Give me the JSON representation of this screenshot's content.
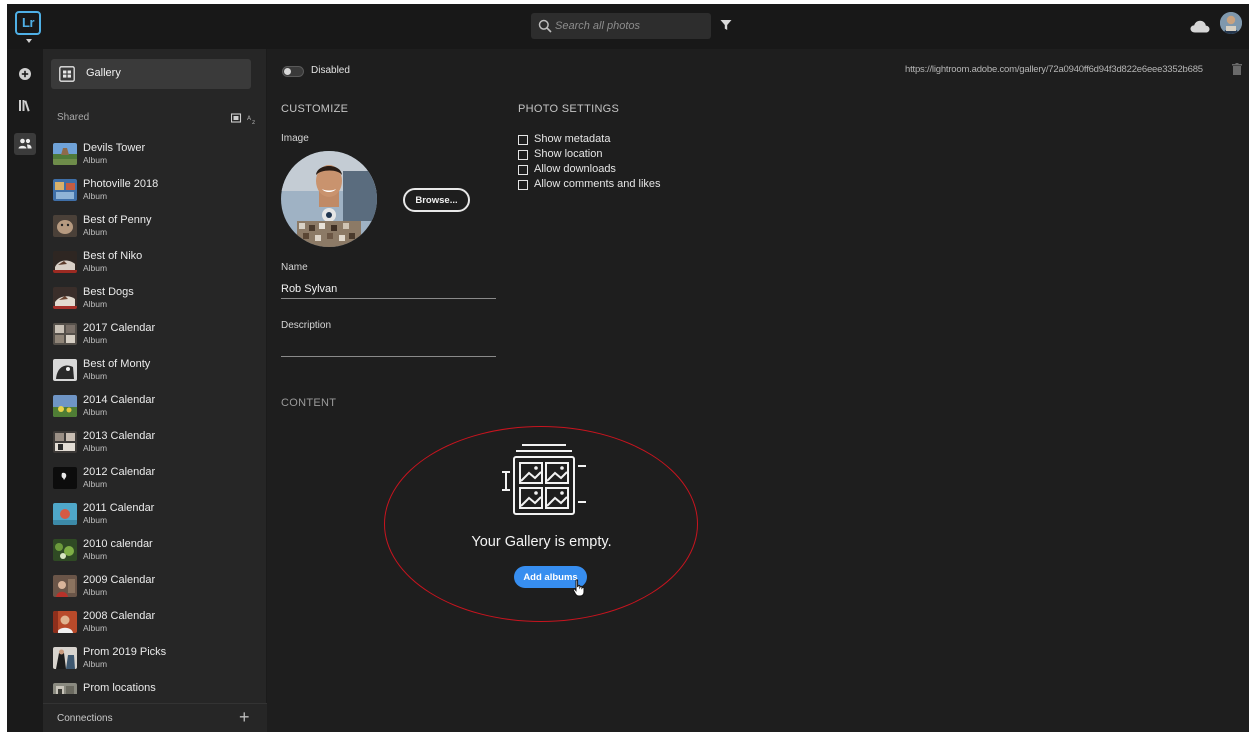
{
  "app": {
    "logo_text": "Lr"
  },
  "search": {
    "placeholder": "Search all photos"
  },
  "sidebar": {
    "gallery_label": "Gallery",
    "shared_header": "Shared",
    "connections_label": "Connections",
    "albums": [
      {
        "name": "Devils Tower",
        "type": "Album"
      },
      {
        "name": "Photoville 2018",
        "type": "Album"
      },
      {
        "name": "Best of Penny",
        "type": "Album"
      },
      {
        "name": "Best of Niko",
        "type": "Album"
      },
      {
        "name": "Best Dogs",
        "type": "Album"
      },
      {
        "name": "2017 Calendar",
        "type": "Album"
      },
      {
        "name": "Best of Monty",
        "type": "Album"
      },
      {
        "name": "2014 Calendar",
        "type": "Album"
      },
      {
        "name": "2013 Calendar",
        "type": "Album"
      },
      {
        "name": "2012 Calendar",
        "type": "Album"
      },
      {
        "name": "2011 Calendar",
        "type": "Album"
      },
      {
        "name": "2010 calendar",
        "type": "Album"
      },
      {
        "name": "2009 Calendar",
        "type": "Album"
      },
      {
        "name": "2008 Calendar",
        "type": "Album"
      },
      {
        "name": "Prom 2019 Picks",
        "type": "Album"
      },
      {
        "name": "Prom locations",
        "type": "Album"
      }
    ]
  },
  "main": {
    "toggle_label": "Disabled",
    "gallery_url": "https://lightroom.adobe.com/gallery/72a0940ff6d94f3d822e6eee3352b685",
    "customize_title": "CUSTOMIZE",
    "image_label": "Image",
    "browse_label": "Browse...",
    "name_label": "Name",
    "name_value": "Rob Sylvan",
    "description_label": "Description",
    "description_value": "",
    "photo_settings_title": "PHOTO SETTINGS",
    "photo_settings": [
      {
        "label": "Show metadata",
        "checked": false
      },
      {
        "label": "Show location",
        "checked": false
      },
      {
        "label": "Allow downloads",
        "checked": false
      },
      {
        "label": "Allow comments and likes",
        "checked": false
      }
    ],
    "content_title": "CONTENT",
    "empty_text": "Your Gallery is empty.",
    "add_albums_label": "Add albums"
  },
  "colors": {
    "accent": "#378ef0",
    "logo": "#4fb0e6",
    "highlight_ellipse": "#c8141e"
  }
}
